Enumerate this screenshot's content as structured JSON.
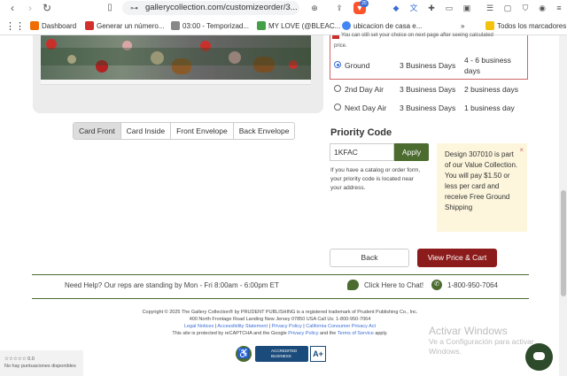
{
  "browser": {
    "url": "gallerycollection.com/customizeorder/3...",
    "extension_badge": "25",
    "bookmarks": [
      {
        "label": "Dashboard",
        "color": "#ef6c00"
      },
      {
        "label": "Generar un número...",
        "color": "#d32f2f"
      },
      {
        "label": "03:00 - Temporizad...",
        "color": "#888888"
      },
      {
        "label": "MY LOVE (@BLEAC...",
        "color": "#43a047"
      },
      {
        "label": "ubicacion de casa e...",
        "color": "#4285f4"
      }
    ],
    "all_bookmarks": "Todos los marcadores"
  },
  "preview": {
    "tabs": [
      "Card Front",
      "Card Inside",
      "Front Envelope",
      "Back Envelope"
    ],
    "active_tab": "Card Front"
  },
  "shipping": {
    "top_text": "You can still set your choice on next page after seeing calculated",
    "top_text_2": "price.",
    "options": [
      {
        "name": "Ground",
        "time": "3 Business Days",
        "delivery": "4 - 6 business",
        "delivery_2": "days",
        "selected": true
      },
      {
        "name": "2nd Day Air",
        "time": "3 Business Days",
        "delivery": "2 business days",
        "delivery_2": "",
        "selected": false
      },
      {
        "name": "Next Day Air",
        "time": "3 Business Days",
        "delivery": "1 business day",
        "delivery_2": "",
        "selected": false
      }
    ]
  },
  "priority": {
    "title": "Priority Code",
    "input_value": "1KFAC",
    "apply_label": "Apply",
    "help": "If you have a catalog or order form, your priority code is located near your address."
  },
  "promo": {
    "text": "Design 307010 is part of our Value Collection. You will pay $1.50 or less per card and receive Free Ground Shipping",
    "close": "×"
  },
  "actions": {
    "back": "Back",
    "view_price": "View Price & Cart"
  },
  "help_bar": {
    "text": "Need Help? Our reps are standing by Mon - Fri 8:00am - 6:00pm ET",
    "chat": "Click Here to Chat!",
    "phone": "1-800-950-7064"
  },
  "footer": {
    "line1": "Copyright © 2025 The Gallery Collection® by PRUDENT PUBLISHING is a registered trademark of Prudent Publishing Co., Inc.",
    "line2": "400 North Frontage Road Landing New Jersey 07850 USA Call Us: 1-800-950-7064",
    "link_legal": "Legal Notices",
    "link_access": "Accessibility Statement",
    "link_privacy": "Privacy Policy",
    "link_ca": "California Consumer Privacy Act",
    "line4_prefix": "This site is protected by reCAPTCHA and the Google",
    "link_google_privacy": "Privacy Policy",
    "line4_and": "and the",
    "link_terms": "Terms of Service",
    "line4_suffix": "apply.",
    "bbb": "ACCREDITED BUSINESS",
    "bbb_grade": "A+"
  },
  "rating_widget": {
    "stars": "☆☆☆☆☆ 0.0",
    "text": "No hay puntuaciones disponibles"
  },
  "watermark": {
    "title": "Activar Windows",
    "sub1": "Ve a Configuración para activar",
    "sub2": "Windows."
  }
}
